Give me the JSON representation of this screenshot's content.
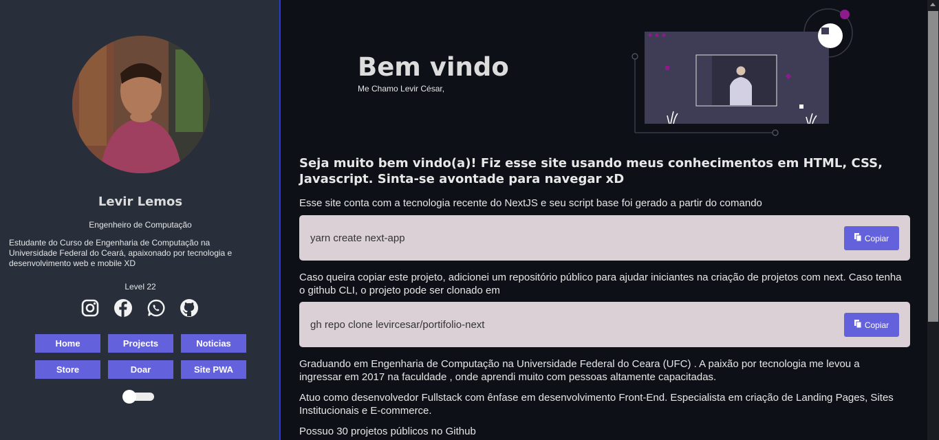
{
  "profile": {
    "name": "Levir Lemos",
    "role": "Engenheiro de Computação",
    "bio": "Estudante do Curso de Engenharia de Computação na Universidade Federal do Ceará, apaixonado por tecnologia e desenvolvimento web e mobile XD",
    "level": "Level 22",
    "socials": [
      "instagram-icon",
      "facebook-icon",
      "whatsapp-icon",
      "github-icon"
    ]
  },
  "nav": {
    "home": "Home",
    "projects": "Projects",
    "noticias": "Noticias",
    "store": "Store",
    "doar": "Doar",
    "site_pwa": "Site PWA"
  },
  "hero": {
    "title": "Bem vindo",
    "subtitle": "Me Chamo Levir César,"
  },
  "content": {
    "heading": "Seja muito bem vindo(a)! Fiz esse site usando meus conhecimentos em HTML, CSS, Javascript. Sinta-se avontade para navegar xD",
    "p1": "Esse site conta com a tecnologia recente do NextJS e seu script base foi gerado a partir do comando",
    "code1": "yarn create next-app",
    "p2": "Caso queira copiar este projeto, adicionei um repositório público para ajudar iniciantes na criação de projetos com next. Caso tenha o github CLI, o projeto pode ser clonado em",
    "code2": "gh repo clone levircesar/portifolio-next",
    "p3": "Graduando em Engenharia de Computação na Universidade Federal do Ceara (UFC) . A paixão por tecnologia me levou a ingressar em 2017 na faculdade , onde aprendi muito com pessoas altamente capacitadas.",
    "p4": "Atuo como desenvolvedor Fullstack com ênfase em desenvolvimento Front-End. Especialista em criação de Landing Pages, Sites Institucionais e E-commerce.",
    "p5": "Possuo 30 projetos públicos no Github",
    "copy_label": "Copiar"
  },
  "colors": {
    "sidebar_bg": "#282f3a",
    "main_bg": "#0d1117",
    "accent": "#6461dc",
    "codebox_bg": "#dbd0d6"
  }
}
